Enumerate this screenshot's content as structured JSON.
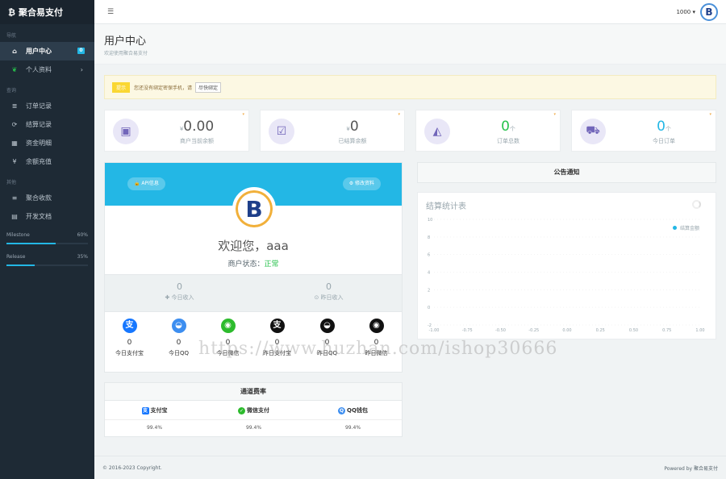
{
  "brand": {
    "icon": "₿",
    "name": "聚合易支付"
  },
  "sidebar": {
    "section1": "导航",
    "items1": [
      {
        "icon": "⌂",
        "label": "用户中心",
        "badge": "0"
      },
      {
        "icon": "❦",
        "label": "个人资料",
        "chevron": "›"
      }
    ],
    "section2": "查询",
    "items2": [
      {
        "icon": "≣",
        "label": "订单记录"
      },
      {
        "icon": "⟳",
        "label": "结算记录"
      },
      {
        "icon": "▦",
        "label": "资金明细"
      },
      {
        "icon": "¥",
        "label": "余额充值"
      }
    ],
    "section3": "其他",
    "items3": [
      {
        "icon": "≡",
        "label": "聚合收款"
      },
      {
        "icon": "▤",
        "label": "开发文档"
      }
    ],
    "progress": [
      {
        "label": "Milestone",
        "value": "60%",
        "fraction": 0.6
      },
      {
        "label": "Release",
        "value": "35%",
        "fraction": 0.35
      }
    ]
  },
  "topbar": {
    "menu_icon": "☰",
    "user": "1000 ▾",
    "avatar": "B"
  },
  "page": {
    "title": "用户中心",
    "subtitle": "欢迎使用聚合易支付"
  },
  "alert": {
    "tag": "提示",
    "text": "您还没有绑定密保手机，请",
    "button": "尽快绑定"
  },
  "stats": [
    {
      "icon": "▣",
      "prefix": "¥",
      "value": "0.00",
      "unit": "",
      "label": "商户当前余额",
      "color": "#555"
    },
    {
      "icon": "☑",
      "prefix": "¥",
      "value": "0",
      "unit": "",
      "label": "已结算余额",
      "color": "#555"
    },
    {
      "icon": "◭",
      "prefix": "",
      "value": "0",
      "unit": "个",
      "label": "订单总数",
      "color": "#27c24c"
    },
    {
      "icon": "⛟",
      "prefix": "",
      "value": "0",
      "unit": "个",
      "label": "今日订单",
      "color": "#23b7e5"
    }
  ],
  "stat_corner": "▾",
  "profile": {
    "api_button": "🔒 API信息",
    "edit_button": "⚙ 修改资料",
    "logo": "B",
    "welcome": "欢迎您，aaa",
    "status_label": "商户状态：",
    "status_value": "正常"
  },
  "income": [
    {
      "value": "0",
      "label": "✚ 今日收入"
    },
    {
      "value": "0",
      "label": "⊙ 昨日收入"
    }
  ],
  "pays": [
    {
      "icon": "支",
      "color": "#1677ff",
      "value": "0",
      "label": "今日支付宝"
    },
    {
      "icon": "◒",
      "color": "#3d8ef0",
      "value": "0",
      "label": "今日QQ"
    },
    {
      "icon": "◉",
      "color": "#2dbb2d",
      "value": "0",
      "label": "今日微信"
    },
    {
      "icon": "支",
      "color": "#111111",
      "value": "0",
      "label": "昨日支付宝"
    },
    {
      "icon": "◒",
      "color": "#111111",
      "value": "0",
      "label": "昨日QQ"
    },
    {
      "icon": "◉",
      "color": "#111111",
      "value": "0",
      "label": "昨日微信"
    }
  ],
  "rates": {
    "title": "通道费率",
    "channels": [
      {
        "icon": "支",
        "color": "#1677ff",
        "name": "支付宝",
        "rate": "99.4%"
      },
      {
        "icon": "✓",
        "color": "#2dbb2d",
        "name": "微信支付",
        "rate": "99.4%"
      },
      {
        "icon": "Q",
        "color": "#3d8ef0",
        "name": "QQ钱包",
        "rate": "99.4%"
      }
    ]
  },
  "notice": {
    "title": "公告通知"
  },
  "chart_data": {
    "type": "line",
    "title": "结算统计表",
    "series": [
      {
        "name": "结算金额",
        "values": []
      }
    ],
    "x_ticks": [
      "-1.00",
      "-0.75",
      "-0.50",
      "-0.25",
      "0.00",
      "0.25",
      "0.50",
      "0.75",
      "1.00"
    ],
    "y_ticks": [
      "10",
      "8",
      "6",
      "4",
      "2",
      "0",
      "-2"
    ],
    "xlim": [
      -1,
      1
    ],
    "ylim": [
      -2,
      10
    ],
    "grid": true,
    "legend": "top-right"
  },
  "footer": {
    "left": "© 2016-2023 Copyright.",
    "right": "Powered by 聚合易支付"
  },
  "watermark": "https://www.huzhan.com/ishop30666"
}
